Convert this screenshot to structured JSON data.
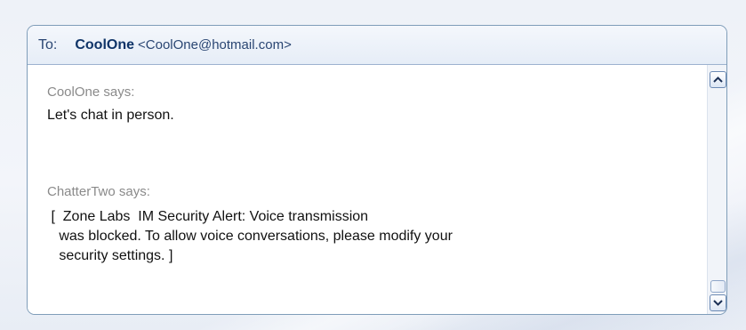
{
  "header": {
    "to_label": "To:",
    "contact_name": "CoolOne",
    "contact_email": "<CoolOne@hotmail.com>"
  },
  "conversation": [
    {
      "sender": "CoolOne says:",
      "text": "Let's chat in person."
    },
    {
      "sender": "ChatterTwo says:",
      "text": " [  Zone Labs  IM Security Alert: Voice transmission\n   was blocked. To allow voice conversations, please modify your\n   security settings. ]"
    }
  ],
  "icons": {
    "scroll_up": "chevron-up-icon",
    "scroll_down": "chevron-down-icon"
  },
  "colors": {
    "border": "#7f9db9",
    "header_text": "#0f3468",
    "sender_text": "#8a8a8a",
    "message_text": "#111111"
  }
}
